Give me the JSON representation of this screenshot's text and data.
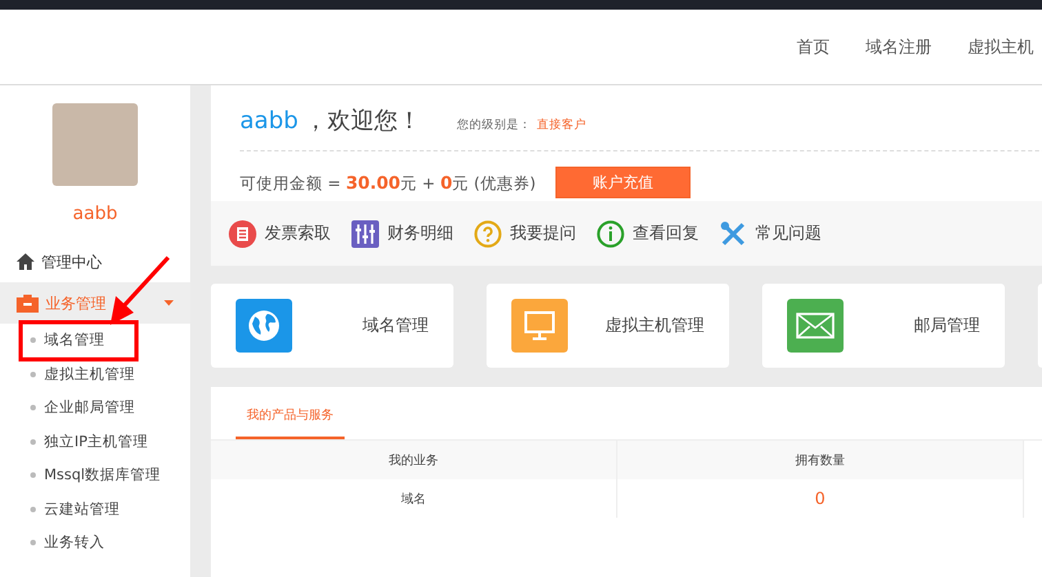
{
  "header": {
    "nav": [
      {
        "label": "首页"
      },
      {
        "label": "域名注册"
      },
      {
        "label": "虚拟主机"
      }
    ]
  },
  "sidebar": {
    "username": "aabb",
    "menu": [
      {
        "label": "管理中心",
        "kind": "home",
        "expanded": false
      },
      {
        "label": "业务管理",
        "kind": "case",
        "expanded": true,
        "children": [
          {
            "label": "域名管理"
          },
          {
            "label": "虚拟主机管理"
          },
          {
            "label": "企业邮局管理"
          },
          {
            "label": "独立IP主机管理"
          },
          {
            "label": "Mssql数据库管理"
          },
          {
            "label": "云建站管理"
          },
          {
            "label": "业务转入"
          }
        ]
      }
    ]
  },
  "welcome": {
    "username": "aabb",
    "greeting": "，欢迎您！",
    "level_label": "您的级别是：",
    "level": "直接客户",
    "balance": "可使用金额 = **30.00**元 + **0**元 (优惠券)",
    "button": "账户充值"
  },
  "quick_links": [
    {
      "label": "发票索取",
      "kind": "invoice"
    },
    {
      "label": "财务明细",
      "kind": "sliders"
    },
    {
      "label": "我要提问",
      "kind": "question"
    },
    {
      "label": "查看回复",
      "kind": "info"
    },
    {
      "label": "常见问题",
      "kind": "tools"
    }
  ],
  "service_cards": [
    {
      "label": "域名管理",
      "kind": "globe"
    },
    {
      "label": "虚拟主机管理",
      "kind": "monitor"
    },
    {
      "label": "邮局管理",
      "kind": "mail"
    }
  ],
  "products": {
    "tabs": [
      {
        "label": "我的产品与服务",
        "selected": true
      }
    ],
    "columns": [
      "我的业务",
      "拥有数量"
    ],
    "rows": [
      {
        "cells": [
          "域名",
          "0"
        ]
      }
    ]
  }
}
